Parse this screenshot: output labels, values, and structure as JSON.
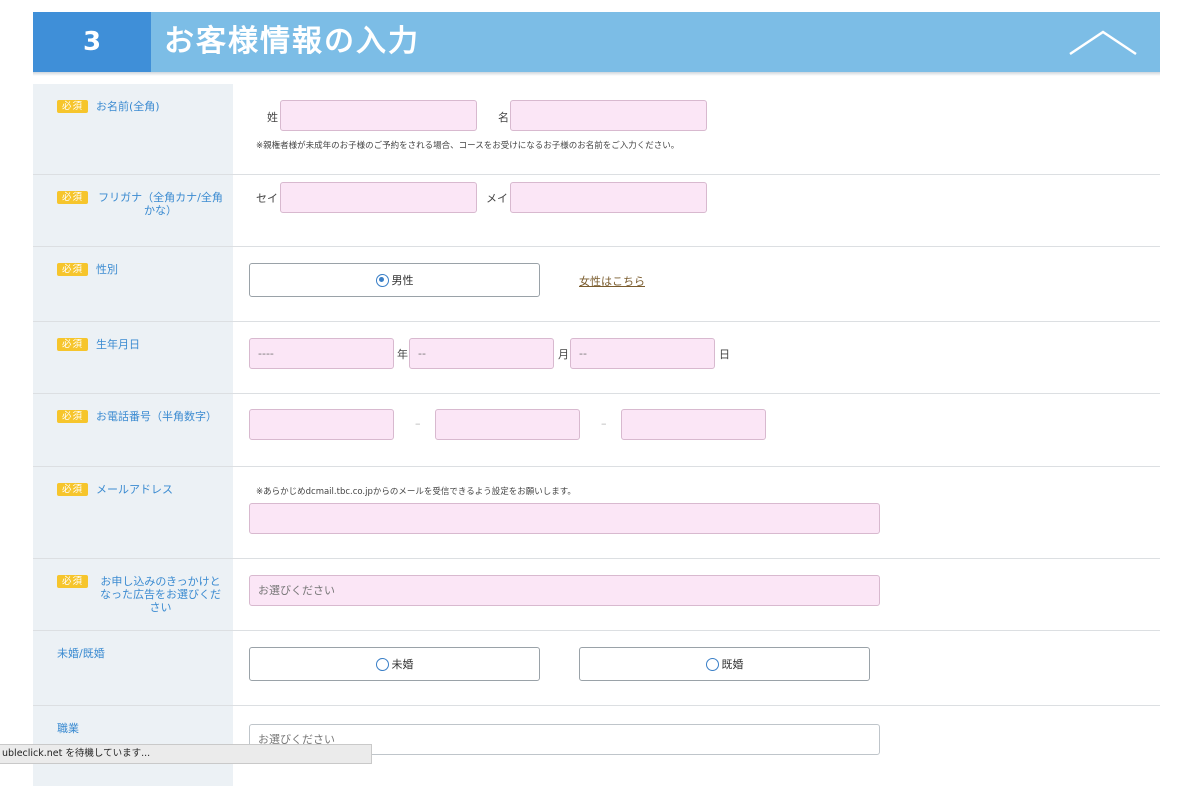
{
  "header": {
    "step_number": "3",
    "title": "お客様情報の入力"
  },
  "required_label": "必須",
  "name_row": {
    "label": "お名前(全角)",
    "sei_label": "姓",
    "mei_label": "名",
    "sei_value": "",
    "mei_value": "",
    "note": "※親権者様が未成年のお子様のご予約をされる場合、コースをお受けになるお子様のお名前をご入力ください。"
  },
  "kana_row": {
    "label": "フリガナ（全角カナ/全角かな）",
    "sei_label": "セイ",
    "mei_label": "メイ",
    "sei_value": "",
    "mei_value": ""
  },
  "gender_row": {
    "label": "性別",
    "option": "男性",
    "female_link": "女性はこちら"
  },
  "birth_row": {
    "label": "生年月日",
    "year_value": "----",
    "year_label": "年",
    "month_value": "--",
    "month_label": "月",
    "day_value": "--",
    "day_label": "日"
  },
  "phone_row": {
    "label": "お電話番号（半角数字）",
    "separator": "–",
    "part1": "",
    "part2": "",
    "part3": ""
  },
  "email_row": {
    "label": "メールアドレス",
    "note": "※あらかじめdcmail.tbc.co.jpからのメールを受信できるよう設定をお願いします。",
    "value": ""
  },
  "source_row": {
    "label": "お申し込みのきっかけとなった広告をお選びください",
    "placeholder": "お選びください"
  },
  "marital_row": {
    "label": "未婚/既婚",
    "option_single": "未婚",
    "option_married": "既婚"
  },
  "job_row": {
    "label": "職業",
    "placeholder": "お選びください"
  },
  "status_bar": {
    "text": "ubleclick.net を待機しています..."
  },
  "colors": {
    "header_bg": "#7cbde6",
    "step_bg": "#3f8fd8",
    "label_bg": "#ecf1f5",
    "label_text": "#3b8bd1",
    "required_badge": "#f6c52c",
    "input_bg": "#fbe6f6"
  },
  "icons": {
    "collapse": "chevron-up-icon",
    "radio_selected": "radio-checked-icon",
    "radio_unselected": "radio-unchecked-icon"
  }
}
